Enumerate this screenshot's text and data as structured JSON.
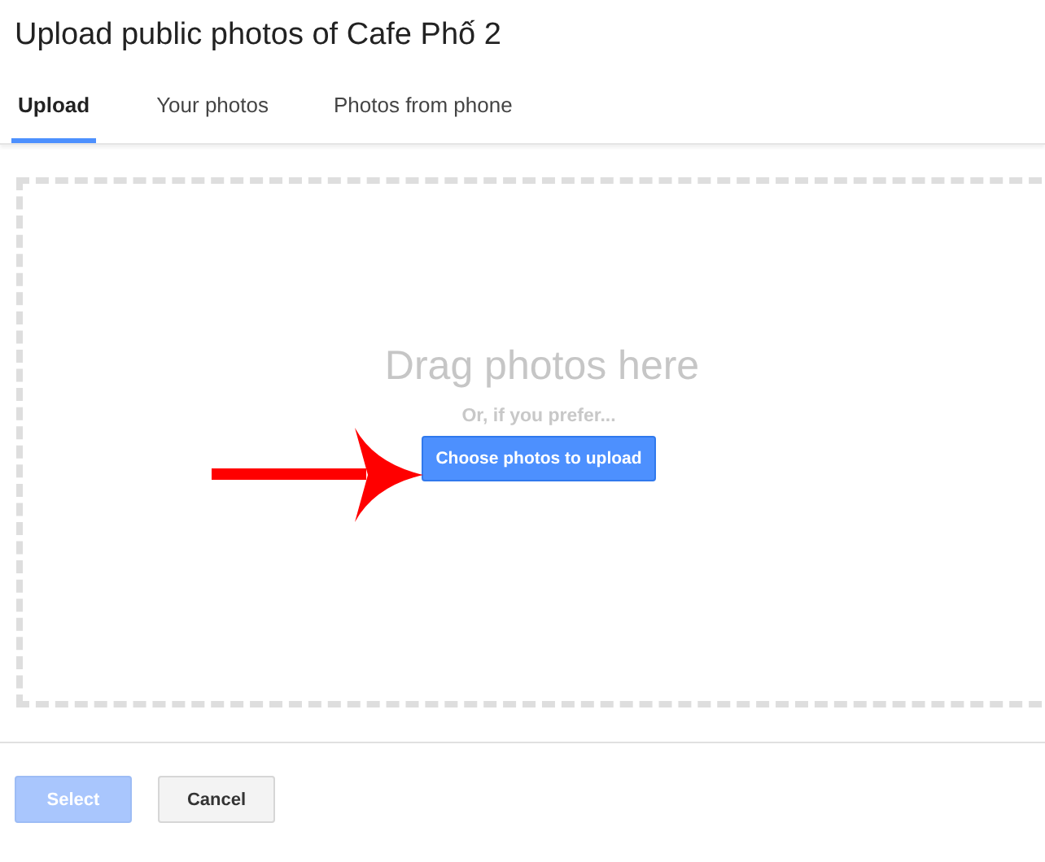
{
  "dialog": {
    "title": "Upload public photos of Cafe Phố 2"
  },
  "tabs": [
    {
      "label": "Upload",
      "selected": true
    },
    {
      "label": "Your photos",
      "selected": false
    },
    {
      "label": "Photos from phone",
      "selected": false
    }
  ],
  "drop_zone": {
    "heading": "Drag photos here",
    "subtext": "Or, if you prefer...",
    "button": "Choose photos to upload"
  },
  "footer_buttons": [
    {
      "label": "Select",
      "kind": "primary",
      "disabled": true
    },
    {
      "label": "Cancel",
      "kind": "secondary",
      "disabled": false
    }
  ]
}
